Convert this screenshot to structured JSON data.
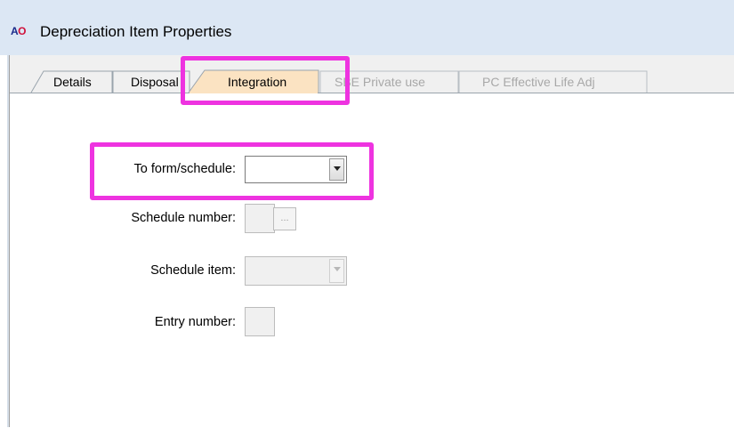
{
  "window": {
    "logo_a": "A",
    "logo_o": "O",
    "title": "Depreciation Item Properties"
  },
  "tabs": [
    {
      "label": "Details",
      "enabled": true,
      "active": false
    },
    {
      "label": "Disposal",
      "enabled": true,
      "active": false
    },
    {
      "label": "Integration",
      "enabled": true,
      "active": true
    },
    {
      "label": "SBE Private use",
      "enabled": false,
      "active": false
    },
    {
      "label": "PC Effective Life Adj",
      "enabled": false,
      "active": false
    }
  ],
  "form": {
    "to_form_schedule_label": "To form/schedule:",
    "to_form_schedule_value": "",
    "schedule_number_label": "Schedule number:",
    "schedule_number_button": "...",
    "schedule_item_label": "Schedule item:",
    "entry_number_label": "Entry number:"
  },
  "colors": {
    "highlight": "#ee33e0",
    "active_tab": "#fbe3c2",
    "titlebar": "#dce7f4"
  }
}
